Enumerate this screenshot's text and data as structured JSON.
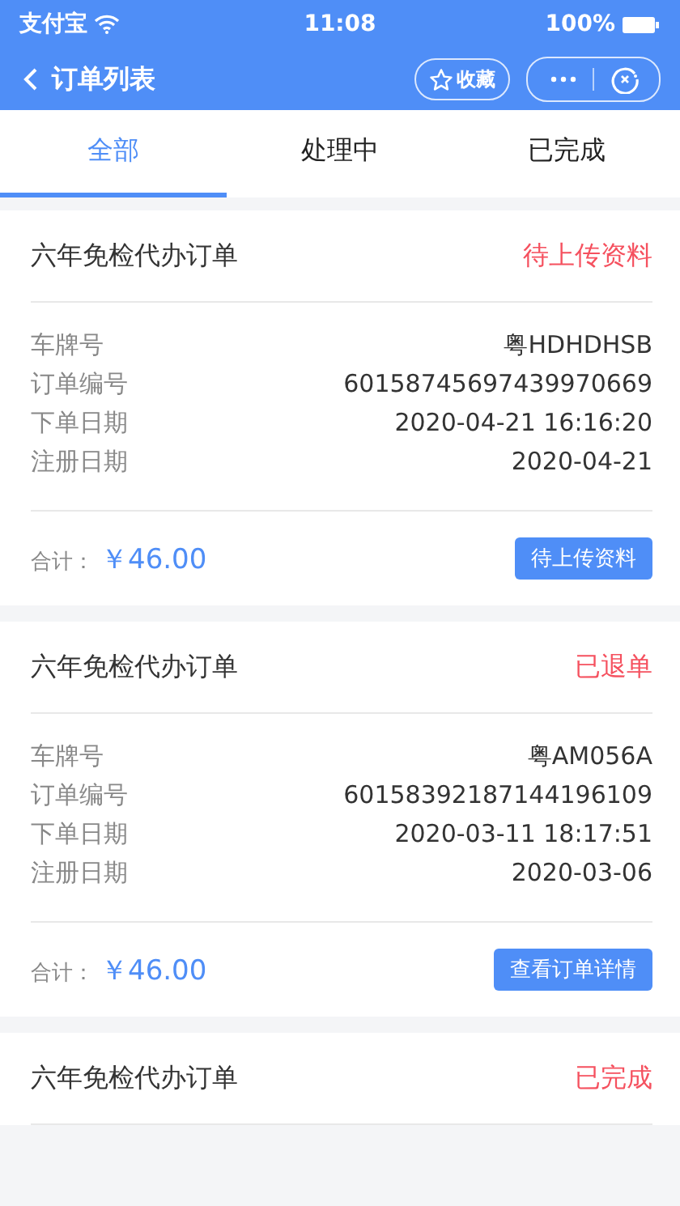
{
  "status_bar": {
    "carrier": "支付宝",
    "time": "11:08",
    "battery": "100%"
  },
  "nav": {
    "title": "订单列表",
    "favorite": "收藏"
  },
  "tabs": [
    {
      "label": "全部",
      "selected": true
    },
    {
      "label": "处理中",
      "selected": false
    },
    {
      "label": "已完成",
      "selected": false
    }
  ],
  "orders": [
    {
      "title": "六年免检代办订单",
      "status": "待上传资料",
      "fields": [
        {
          "label": "车牌号",
          "value": "粤HDHDHSB"
        },
        {
          "label": "订单编号",
          "value": "60158745697439970669"
        },
        {
          "label": "下单日期",
          "value": "2020-04-21 16:16:20"
        },
        {
          "label": "注册日期",
          "value": "2020-04-21"
        }
      ],
      "total_label": "合计：",
      "total": "￥46.00",
      "action": "待上传资料"
    },
    {
      "title": "六年免检代办订单",
      "status": "已退单",
      "fields": [
        {
          "label": "车牌号",
          "value": "粤AM056A"
        },
        {
          "label": "订单编号",
          "value": "60158392187144196109"
        },
        {
          "label": "下单日期",
          "value": "2020-03-11 18:17:51"
        },
        {
          "label": "注册日期",
          "value": "2020-03-06"
        }
      ],
      "total_label": "合计：",
      "total": "￥46.00",
      "action": "查看订单详情"
    },
    {
      "title": "六年免检代办订单",
      "status": "已完成"
    }
  ]
}
